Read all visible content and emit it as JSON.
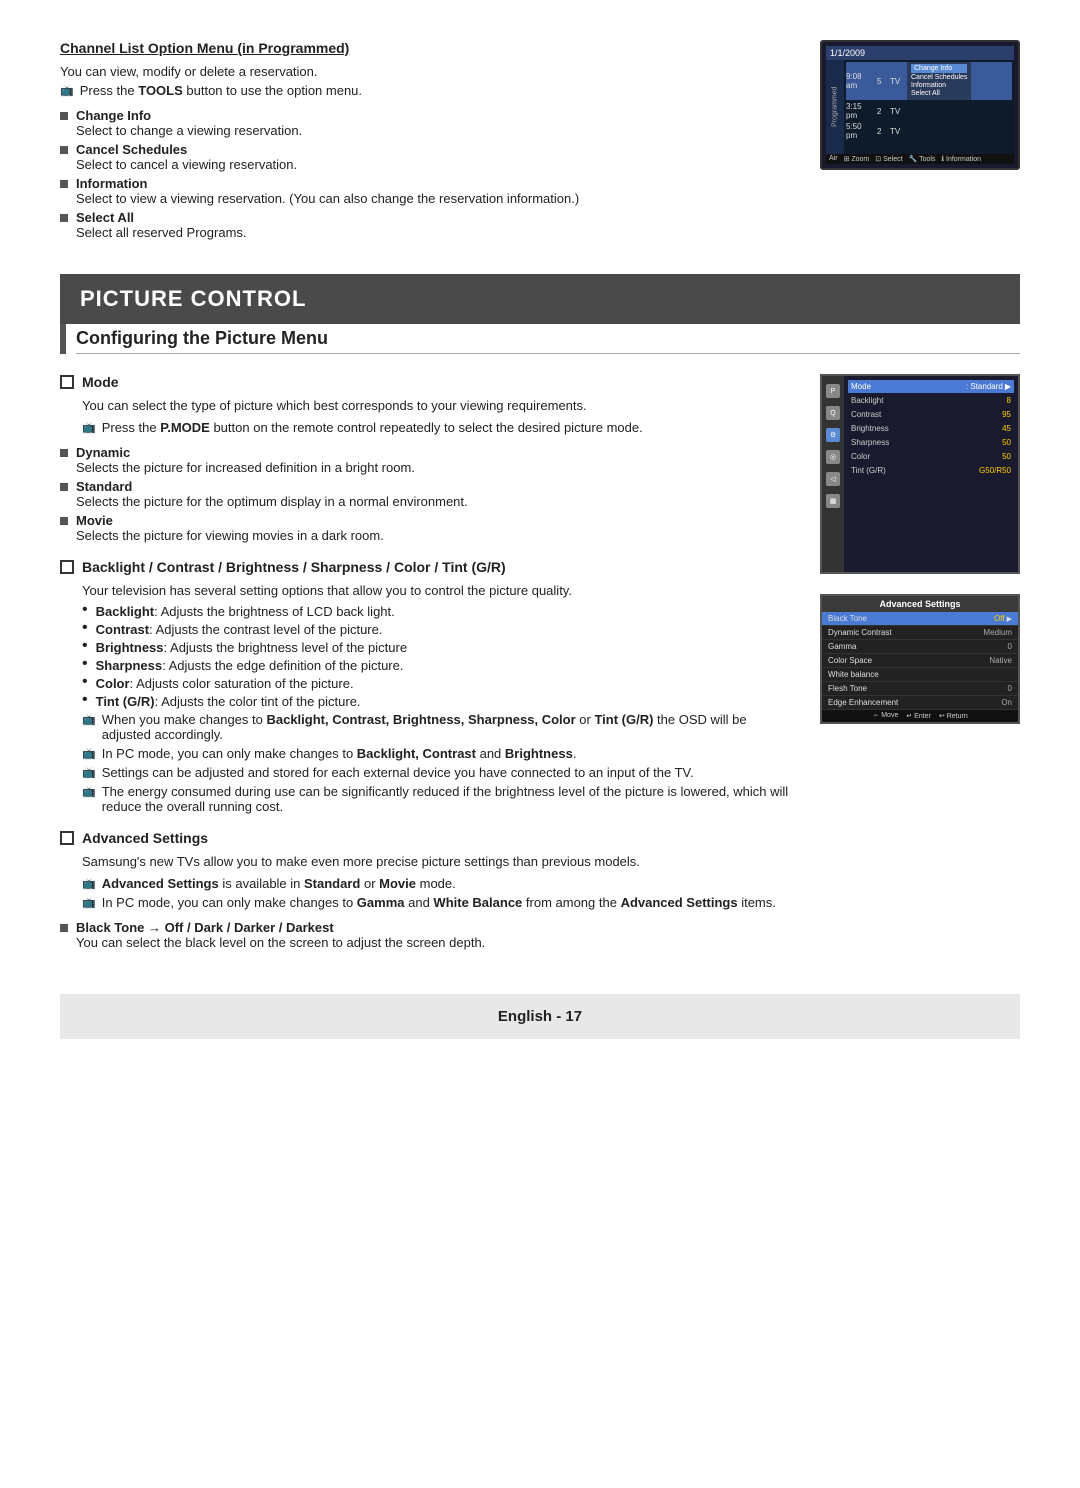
{
  "top": {
    "heading": "Channel List Option Menu (in Programmed)",
    "intro1": "You can view, modify or delete a reservation.",
    "intro2_icon": "📺",
    "intro2": "Press the TOOLS button to use the option menu.",
    "items": [
      {
        "label": "Change Info",
        "desc": "Select to change a viewing reservation."
      },
      {
        "label": "Cancel Schedules",
        "desc": "Select to cancel a viewing reservation."
      },
      {
        "label": "Information",
        "desc": "Select to view a viewing reservation. (You can also change the reservation information.)"
      },
      {
        "label": "Select All",
        "desc": "Select all reserved Programs."
      }
    ],
    "tv": {
      "date": "1/1/2009",
      "time": "9:08 am",
      "ch": "5",
      "type": "TV",
      "rows": [
        {
          "time": "3:15 pm",
          "ch": "2",
          "type": "TV"
        },
        {
          "time": "5:50 pm",
          "ch": "2",
          "type": "TV"
        }
      ],
      "menu": [
        "Change Info",
        "Cancel Schedules",
        "Information",
        "Select All"
      ],
      "bottom": [
        "Air",
        "Zoom",
        "Select",
        "Tools",
        "Information"
      ]
    }
  },
  "picture_control": {
    "banner": "PICTURE CONTROL",
    "configuring": "Configuring the Picture Menu"
  },
  "mode": {
    "heading": "Mode",
    "desc": "You can select the type of picture which best corresponds to your viewing requirements.",
    "note": "Press the P.MODE button on the remote control repeatedly to select the desired picture mode.",
    "items": [
      {
        "label": "Dynamic",
        "desc": "Selects the picture for increased definition in a bright room."
      },
      {
        "label": "Standard",
        "desc": "Selects the picture for the optimum display in a normal environment."
      },
      {
        "label": "Movie",
        "desc": "Selects the picture for viewing movies in a dark room."
      }
    ],
    "tv": {
      "rows": [
        {
          "label": "Mode",
          "value": "Standard",
          "selected": true
        },
        {
          "label": "Backlight",
          "value": "8"
        },
        {
          "label": "Contrast",
          "value": "95"
        },
        {
          "label": "Brightness",
          "value": "45"
        },
        {
          "label": "Sharpness",
          "value": "50"
        },
        {
          "label": "Color",
          "value": "50"
        },
        {
          "label": "Tint (G/R)",
          "value": "G50/R50"
        }
      ]
    }
  },
  "backlight": {
    "heading": "Backlight / Contrast / Brightness / Sharpness / Color / Tint (G/R)",
    "desc": "Your television has several setting options that allow you to control the picture quality.",
    "items": [
      {
        "label": "Backlight",
        "desc": ": Adjusts the brightness of LCD back light."
      },
      {
        "label": "Contrast",
        "desc": ": Adjusts the contrast level of the picture."
      },
      {
        "label": "Brightness",
        "desc": ": Adjusts the brightness level of the picture"
      },
      {
        "label": "Sharpness",
        "desc": ": Adjusts the edge definition of the picture."
      },
      {
        "label": "Color",
        "desc": ": Adjusts color saturation of the picture."
      },
      {
        "label": "Tint (G/R)",
        "desc": ": Adjusts the color tint of the picture."
      }
    ],
    "notes": [
      "When you make changes to Backlight, Contrast, Brightness, Sharpness, Color or Tint (G/R) the OSD will be adjusted accordingly.",
      "In PC mode, you can only make changes to Backlight, Contrast and Brightness.",
      "Settings can be adjusted and stored for each external device you have connected to an input of the TV.",
      "The energy consumed during use can be significantly reduced if the brightness level of the picture is lowered, which will reduce the overall running cost."
    ]
  },
  "advanced": {
    "heading": "Advanced Settings",
    "desc": "Samsung's new TVs allow you to make even more precise picture settings than previous models.",
    "notes": [
      "Advanced Settings is available in Standard or Movie mode.",
      "In PC mode, you can only make changes to Gamma and White Balance from among the Advanced Settings items."
    ],
    "black_tone": {
      "label": "Black Tone → Off / Dark / Darker / Darkest",
      "desc": "You can select the black level on the screen to adjust the screen depth."
    },
    "tv": {
      "header": "Advanced Settings",
      "rows": [
        {
          "label": "Black Tone",
          "value": "Off",
          "selected": true
        },
        {
          "label": "Dynamic Contrast",
          "value": "Medium"
        },
        {
          "label": "Gamma",
          "value": "0"
        },
        {
          "label": "Color Space",
          "value": "Native"
        },
        {
          "label": "White balance",
          "value": ""
        },
        {
          "label": "Flesh Tone",
          "value": "0"
        },
        {
          "label": "Edge Enhancement",
          "value": "On"
        }
      ],
      "bottom": [
        "Move",
        "Enter",
        "Return"
      ]
    }
  },
  "footer": {
    "text": "English - 17"
  }
}
